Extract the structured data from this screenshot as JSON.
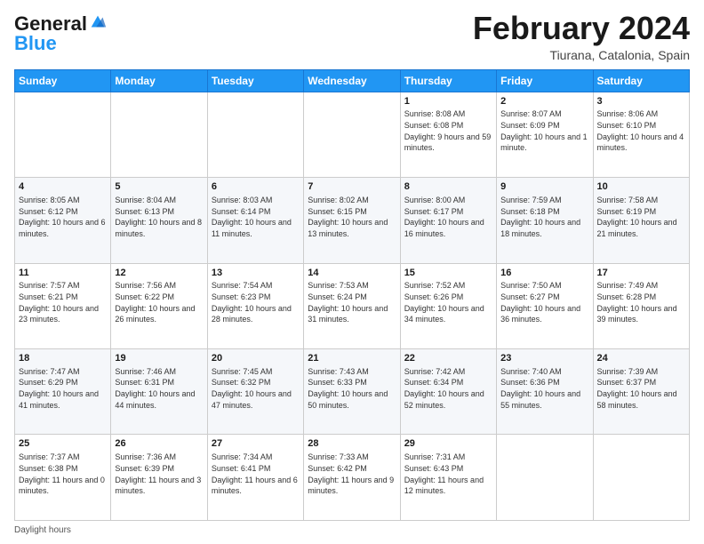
{
  "logo": {
    "text_general": "General",
    "text_blue": "Blue"
  },
  "title": "February 2024",
  "subtitle": "Tiurana, Catalonia, Spain",
  "header_days": [
    "Sunday",
    "Monday",
    "Tuesday",
    "Wednesday",
    "Thursday",
    "Friday",
    "Saturday"
  ],
  "weeks": [
    [
      {
        "day": "",
        "info": ""
      },
      {
        "day": "",
        "info": ""
      },
      {
        "day": "",
        "info": ""
      },
      {
        "day": "",
        "info": ""
      },
      {
        "day": "1",
        "info": "Sunrise: 8:08 AM\nSunset: 6:08 PM\nDaylight: 9 hours and 59 minutes."
      },
      {
        "day": "2",
        "info": "Sunrise: 8:07 AM\nSunset: 6:09 PM\nDaylight: 10 hours and 1 minute."
      },
      {
        "day": "3",
        "info": "Sunrise: 8:06 AM\nSunset: 6:10 PM\nDaylight: 10 hours and 4 minutes."
      }
    ],
    [
      {
        "day": "4",
        "info": "Sunrise: 8:05 AM\nSunset: 6:12 PM\nDaylight: 10 hours and 6 minutes."
      },
      {
        "day": "5",
        "info": "Sunrise: 8:04 AM\nSunset: 6:13 PM\nDaylight: 10 hours and 8 minutes."
      },
      {
        "day": "6",
        "info": "Sunrise: 8:03 AM\nSunset: 6:14 PM\nDaylight: 10 hours and 11 minutes."
      },
      {
        "day": "7",
        "info": "Sunrise: 8:02 AM\nSunset: 6:15 PM\nDaylight: 10 hours and 13 minutes."
      },
      {
        "day": "8",
        "info": "Sunrise: 8:00 AM\nSunset: 6:17 PM\nDaylight: 10 hours and 16 minutes."
      },
      {
        "day": "9",
        "info": "Sunrise: 7:59 AM\nSunset: 6:18 PM\nDaylight: 10 hours and 18 minutes."
      },
      {
        "day": "10",
        "info": "Sunrise: 7:58 AM\nSunset: 6:19 PM\nDaylight: 10 hours and 21 minutes."
      }
    ],
    [
      {
        "day": "11",
        "info": "Sunrise: 7:57 AM\nSunset: 6:21 PM\nDaylight: 10 hours and 23 minutes."
      },
      {
        "day": "12",
        "info": "Sunrise: 7:56 AM\nSunset: 6:22 PM\nDaylight: 10 hours and 26 minutes."
      },
      {
        "day": "13",
        "info": "Sunrise: 7:54 AM\nSunset: 6:23 PM\nDaylight: 10 hours and 28 minutes."
      },
      {
        "day": "14",
        "info": "Sunrise: 7:53 AM\nSunset: 6:24 PM\nDaylight: 10 hours and 31 minutes."
      },
      {
        "day": "15",
        "info": "Sunrise: 7:52 AM\nSunset: 6:26 PM\nDaylight: 10 hours and 34 minutes."
      },
      {
        "day": "16",
        "info": "Sunrise: 7:50 AM\nSunset: 6:27 PM\nDaylight: 10 hours and 36 minutes."
      },
      {
        "day": "17",
        "info": "Sunrise: 7:49 AM\nSunset: 6:28 PM\nDaylight: 10 hours and 39 minutes."
      }
    ],
    [
      {
        "day": "18",
        "info": "Sunrise: 7:47 AM\nSunset: 6:29 PM\nDaylight: 10 hours and 41 minutes."
      },
      {
        "day": "19",
        "info": "Sunrise: 7:46 AM\nSunset: 6:31 PM\nDaylight: 10 hours and 44 minutes."
      },
      {
        "day": "20",
        "info": "Sunrise: 7:45 AM\nSunset: 6:32 PM\nDaylight: 10 hours and 47 minutes."
      },
      {
        "day": "21",
        "info": "Sunrise: 7:43 AM\nSunset: 6:33 PM\nDaylight: 10 hours and 50 minutes."
      },
      {
        "day": "22",
        "info": "Sunrise: 7:42 AM\nSunset: 6:34 PM\nDaylight: 10 hours and 52 minutes."
      },
      {
        "day": "23",
        "info": "Sunrise: 7:40 AM\nSunset: 6:36 PM\nDaylight: 10 hours and 55 minutes."
      },
      {
        "day": "24",
        "info": "Sunrise: 7:39 AM\nSunset: 6:37 PM\nDaylight: 10 hours and 58 minutes."
      }
    ],
    [
      {
        "day": "25",
        "info": "Sunrise: 7:37 AM\nSunset: 6:38 PM\nDaylight: 11 hours and 0 minutes."
      },
      {
        "day": "26",
        "info": "Sunrise: 7:36 AM\nSunset: 6:39 PM\nDaylight: 11 hours and 3 minutes."
      },
      {
        "day": "27",
        "info": "Sunrise: 7:34 AM\nSunset: 6:41 PM\nDaylight: 11 hours and 6 minutes."
      },
      {
        "day": "28",
        "info": "Sunrise: 7:33 AM\nSunset: 6:42 PM\nDaylight: 11 hours and 9 minutes."
      },
      {
        "day": "29",
        "info": "Sunrise: 7:31 AM\nSunset: 6:43 PM\nDaylight: 11 hours and 12 minutes."
      },
      {
        "day": "",
        "info": ""
      },
      {
        "day": "",
        "info": ""
      }
    ]
  ],
  "footer": "Daylight hours"
}
